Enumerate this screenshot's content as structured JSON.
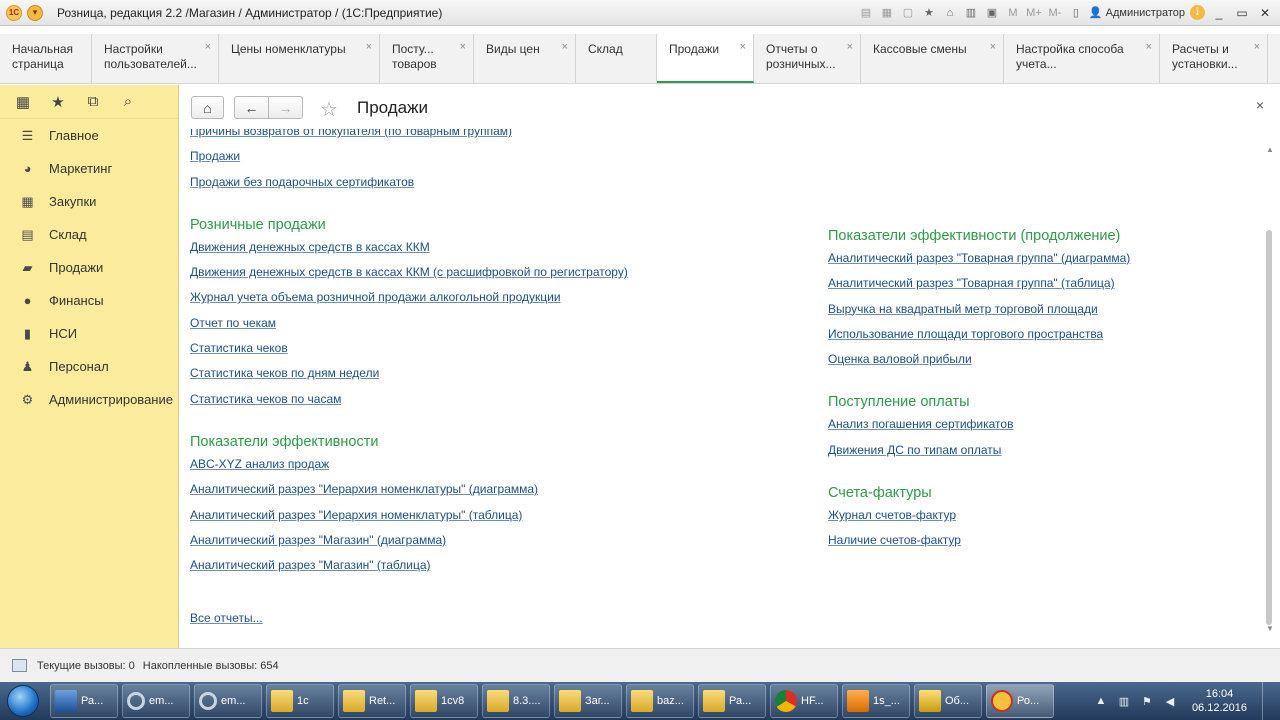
{
  "titlebar": {
    "title": "Розница, редакция 2.2 /Магазин / Администратор /  (1С:Предприятие)",
    "logo_text": "1C",
    "menu_glyph": "▾",
    "user": "Администратор",
    "info_glyph": "i",
    "buttons": [
      "M",
      "M+",
      "M-"
    ],
    "window_controls": [
      "_",
      "▭",
      "✕"
    ]
  },
  "tabs": [
    {
      "label": "Начальная страница",
      "closable": false
    },
    {
      "label": "Настройки пользователей...",
      "closable": true
    },
    {
      "label": "Цены номенклатуры",
      "closable": true
    },
    {
      "label": "Посту... товаров",
      "closable": true
    },
    {
      "label": "Виды цен",
      "closable": true
    },
    {
      "label": "Склад",
      "closable": false
    },
    {
      "label": "Продажи",
      "closable": true,
      "active": true
    },
    {
      "label": "Отчеты о розничных...",
      "closable": true
    },
    {
      "label": "Кассовые смены",
      "closable": true
    },
    {
      "label": "Настройка способа учета...",
      "closable": true
    },
    {
      "label": "Расчеты и установки...",
      "closable": true
    }
  ],
  "tab_close_glyph": "×",
  "sidebar": {
    "tools": [
      "grid-icon",
      "star-icon",
      "history-icon",
      "search-icon"
    ],
    "items": [
      {
        "label": "Главное",
        "icon": "menu-lines-icon"
      },
      {
        "label": "Маркетинг",
        "icon": "pie-chart-icon"
      },
      {
        "label": "Закупки",
        "icon": "cart-icon"
      },
      {
        "label": "Склад",
        "icon": "warehouse-icon"
      },
      {
        "label": "Продажи",
        "icon": "briefcase-icon"
      },
      {
        "label": "Финансы",
        "icon": "ruble-coin-icon"
      },
      {
        "label": "НСИ",
        "icon": "book-icon"
      },
      {
        "label": "Персонал",
        "icon": "person-icon"
      },
      {
        "label": "Администрирование",
        "icon": "gear-icon"
      }
    ]
  },
  "content": {
    "title": "Продажи",
    "close_glyph": "×",
    "left": {
      "top_links": [
        "Причины возвратов от покупателя (по товарным группам)",
        "Продажи",
        "Продажи без подарочных сертификатов"
      ],
      "sections": [
        {
          "title": "Розничные продажи",
          "links": [
            "Движения денежных средств в кассах ККМ",
            "Движения денежных средств в кассах ККМ (с расшифровкой по регистратору)",
            "Журнал учета объема розничной продажи алкогольной продукции",
            "Отчет по чекам",
            "Статистика чеков",
            "Статистика чеков по дням недели",
            "Статистика чеков по часам"
          ]
        },
        {
          "title": "Показатели эффективности",
          "links": [
            "ABC-XYZ анализ продаж",
            "Аналитический разрез \"Иерархия номенклатуры\" (диаграмма)",
            "Аналитический разрез \"Иерархия номенклатуры\" (таблица)",
            "Аналитический разрез \"Магазин\" (диаграмма)",
            "Аналитический разрез \"Магазин\" (таблица)"
          ]
        }
      ],
      "all_reports": "Все отчеты..."
    },
    "right": {
      "sections": [
        {
          "title": "Показатели эффективности (продолжение)",
          "links": [
            "Аналитический разрез \"Товарная группа\" (диаграмма)",
            "Аналитический разрез \"Товарная группа\" (таблица)",
            "Выручка на квадратный метр торговой площади",
            "Использование площади торгового пространства",
            "Оценка валовой прибыли"
          ]
        },
        {
          "title": "Поступление оплаты",
          "links": [
            "Анализ погашения сертификатов",
            "Движения ДС по типам оплаты"
          ]
        },
        {
          "title": "Счета-фактуры",
          "links": [
            "Журнал счетов-фактур",
            "Наличие счетов-фактур"
          ]
        }
      ]
    }
  },
  "status": {
    "current_calls": "Текущие вызовы: 0",
    "accumulated_calls": "Накопленные вызовы: 654"
  },
  "taskbar": {
    "tasks": [
      {
        "label": "Ра...",
        "icon": "desktop-icon"
      },
      {
        "label": "em...",
        "icon": "search-icon"
      },
      {
        "label": "em...",
        "icon": "search-icon"
      },
      {
        "label": "1c",
        "icon": "folder-icon"
      },
      {
        "label": "Ret...",
        "icon": "folder-icon"
      },
      {
        "label": "1cv8",
        "icon": "folder-icon"
      },
      {
        "label": "8.3....",
        "icon": "folder-icon"
      },
      {
        "label": "Заг...",
        "icon": "folder-download-icon"
      },
      {
        "label": "baz...",
        "icon": "folder-icon"
      },
      {
        "label": "Ра...",
        "icon": "folder-icon"
      },
      {
        "label": "HF...",
        "icon": "chrome-icon"
      },
      {
        "label": "1s_...",
        "icon": "pdf-icon"
      },
      {
        "label": "Об...",
        "icon": "paint-icon"
      },
      {
        "label": "Ро...",
        "icon": "1c-icon",
        "active": true
      }
    ],
    "time": "16:04",
    "date": "06.12.2016"
  }
}
